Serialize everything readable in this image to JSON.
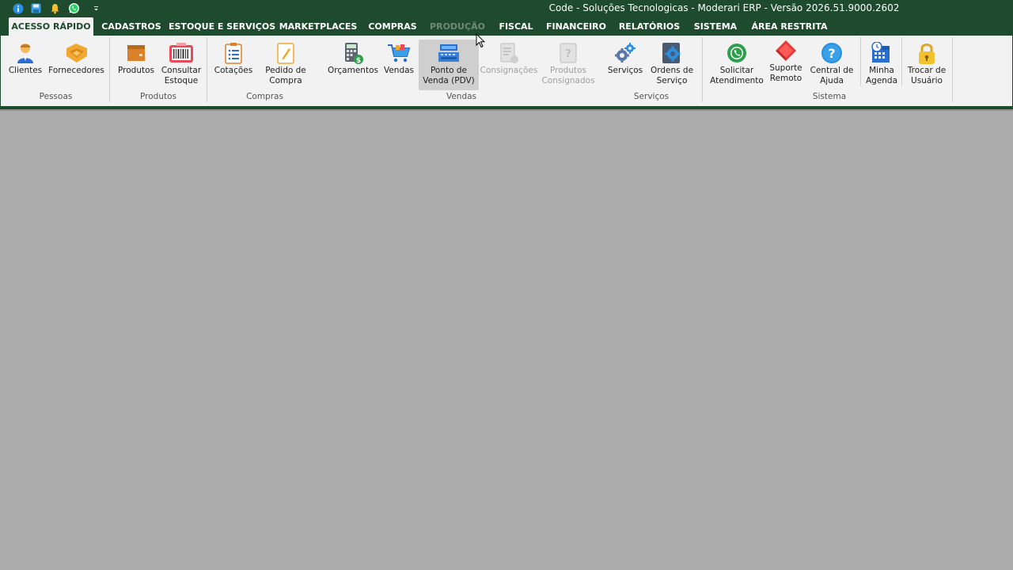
{
  "window": {
    "title": "Code - Soluções Tecnologicas - Moderari ERP - Versão 2026.51.9000.2602"
  },
  "quick_access": [
    {
      "name": "info-icon",
      "color": "#2a8fe0"
    },
    {
      "name": "save-icon",
      "color": "#3aa0e8"
    },
    {
      "name": "bell-icon",
      "color": "#f2c12e"
    },
    {
      "name": "whatsapp-icon",
      "color": "#25d366"
    },
    {
      "name": "customize-dropdown-icon",
      "color": "#ffffff"
    }
  ],
  "tabs": [
    {
      "label": "ACESSO RÁPIDO",
      "active": true
    },
    {
      "label": "CADASTROS"
    },
    {
      "label": "ESTOQUE E SERVIÇOS"
    },
    {
      "label": "MARKETPLACES"
    },
    {
      "label": "COMPRAS"
    },
    {
      "label": "PRODUÇÃO",
      "disabled": true
    },
    {
      "label": "FISCAL"
    },
    {
      "label": "FINANCEIRO"
    },
    {
      "label": "RELATÓRIOS"
    },
    {
      "label": "SISTEMA"
    },
    {
      "label": "ÁREA RESTRITA"
    }
  ],
  "ribbon": {
    "groups": {
      "pessoas": "Pessoas",
      "produtos": "Produtos",
      "compras": "Compras",
      "vendas": "Vendas",
      "servicos": "Serviços",
      "sistema": "Sistema"
    },
    "buttons": {
      "clientes": "Clientes",
      "fornecedores": "Fornecedores",
      "produtos": "Produtos",
      "consultar_estoque": "Consultar\nEstoque",
      "cotacoes": "Cotações",
      "pedido_compra": "Pedido de\nCompra",
      "orcamentos": "Orçamentos",
      "vendas": "Vendas",
      "pdv": "Ponto de\nVenda (PDV)",
      "consignacoes": "Consignações",
      "produtos_consignados": "Produtos\nConsignados",
      "servicos": "Serviços",
      "ordens_servico": "Ordens de\nServiço",
      "solicitar_atendimento": "Solicitar\nAtendimento",
      "suporte_remoto": "Suporte\nRemoto",
      "central_ajuda": "Central de\nAjuda",
      "minha_agenda": "Minha\nAgenda",
      "trocar_usuario": "Trocar de\nUsuário"
    }
  },
  "colors": {
    "titlebar": "#1e4a2e",
    "ribbon": "#f2f2f2",
    "workspace": "#ababab"
  }
}
